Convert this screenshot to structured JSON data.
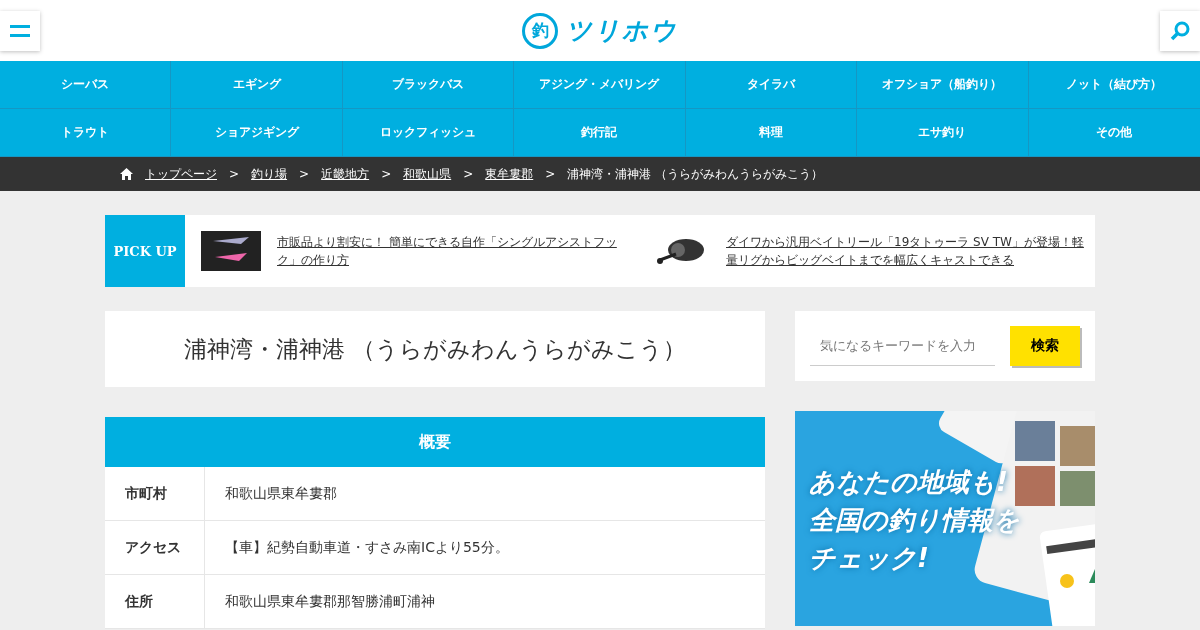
{
  "logo": {
    "mark": "釣",
    "name": "ツリホウ"
  },
  "nav": [
    {
      "label": "シーバス"
    },
    {
      "label": "エギング"
    },
    {
      "label": "ブラックバス"
    },
    {
      "label": "アジング・メバリング"
    },
    {
      "label": "タイラバ"
    },
    {
      "label": "オフショア（船釣り）"
    },
    {
      "label": "ノット（結び方）"
    },
    {
      "label": "トラウト"
    },
    {
      "label": "ショアジギング"
    },
    {
      "label": "ロックフィッシュ"
    },
    {
      "label": "釣行記"
    },
    {
      "label": "料理"
    },
    {
      "label": "エサ釣り"
    },
    {
      "label": "その他"
    }
  ],
  "breadcrumb": [
    {
      "label": "トップページ",
      "link": true
    },
    {
      "label": "釣り場",
      "link": true
    },
    {
      "label": "近畿地方",
      "link": true
    },
    {
      "label": "和歌山県",
      "link": true
    },
    {
      "label": "東牟婁郡",
      "link": true
    },
    {
      "label": "浦神湾・浦神港 （うらがみわんうらがみこう）",
      "link": false
    }
  ],
  "breadcrumb_separator": ">",
  "pickup": {
    "label": "PICK UP",
    "items": [
      {
        "kind": "lure",
        "text": "市販品より割安に！ 簡単にできる自作「シングルアシストフック」の作り方"
      },
      {
        "kind": "reel",
        "text": "ダイワから汎用ベイトリール「19タトゥーラ SV TW」が登場！軽量リグからビッグベイトまでを幅広くキャストできる"
      }
    ]
  },
  "page_title": "浦神湾・浦神港 （うらがみわんうらがみこう）",
  "overview": {
    "title": "概要",
    "rows": [
      {
        "label": "市町村",
        "value": "和歌山県東牟婁郡"
      },
      {
        "label": "アクセス",
        "value": "【車】紀勢自動車道・すさみ南ICより55分。"
      },
      {
        "label": "住所",
        "value": "和歌山県東牟婁郡那智勝浦町浦神"
      }
    ]
  },
  "search": {
    "placeholder": "気になるキーワードを入力",
    "button": "検索"
  },
  "banner": {
    "lines": [
      "あなたの地域も!",
      "全国の釣り情報を",
      "チェック!"
    ]
  }
}
